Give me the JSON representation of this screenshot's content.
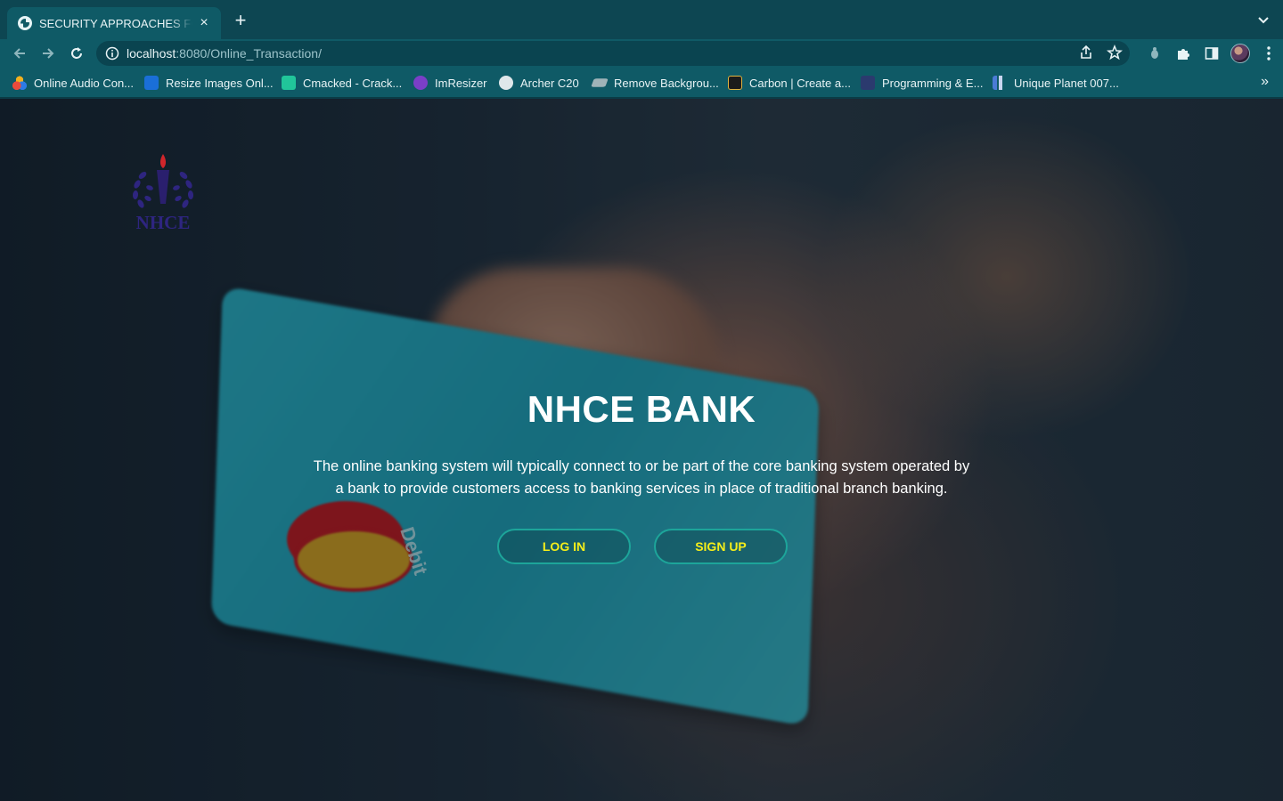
{
  "browser": {
    "tab": {
      "title": "SECURITY APPROACHES FOR",
      "favicon": "globe-icon",
      "close": "×"
    },
    "new_tab": "+",
    "address": {
      "host": "localhost",
      "rest": ":8080/Online_Transaction/"
    },
    "bookmarks": [
      {
        "label": "Online Audio Con...",
        "icon": "audio-converter-icon",
        "color": "#f2b01e"
      },
      {
        "label": "Resize Images Onl...",
        "icon": "resize-images-icon",
        "color": "#1a6fd8"
      },
      {
        "label": "Cmacked - Crack...",
        "icon": "cmacked-icon",
        "color": "#21c59a"
      },
      {
        "label": "ImResizer",
        "icon": "imresizer-icon",
        "color": "#7a3fc7"
      },
      {
        "label": "Archer C20",
        "icon": "globe-icon",
        "color": "#dfe7ea"
      },
      {
        "label": "Remove Backgrou...",
        "icon": "remove-bg-icon",
        "color": "#9fb3b8"
      },
      {
        "label": "Carbon | Create a...",
        "icon": "carbon-icon",
        "color": "#1b1b1b"
      },
      {
        "label": "Programming & E...",
        "icon": "programming-icon",
        "color": "#2b3a6e"
      },
      {
        "label": "Unique Planet 007...",
        "icon": "unique-planet-icon",
        "color": "#4b7bd6"
      }
    ],
    "bookmarks_more": "»"
  },
  "page": {
    "logo_text": "NHCE",
    "title": "NHCE BANK",
    "description": "The online banking system will typically connect to or be part of the core banking system operated by a bank to provide customers access to banking services in place of traditional branch banking.",
    "login_label": "LOG IN",
    "signup_label": "SIGN UP",
    "card_text": "Debit"
  },
  "colors": {
    "accent_border": "#1da59a",
    "button_text": "#f5ee1a",
    "chrome": "#0f5a66"
  }
}
